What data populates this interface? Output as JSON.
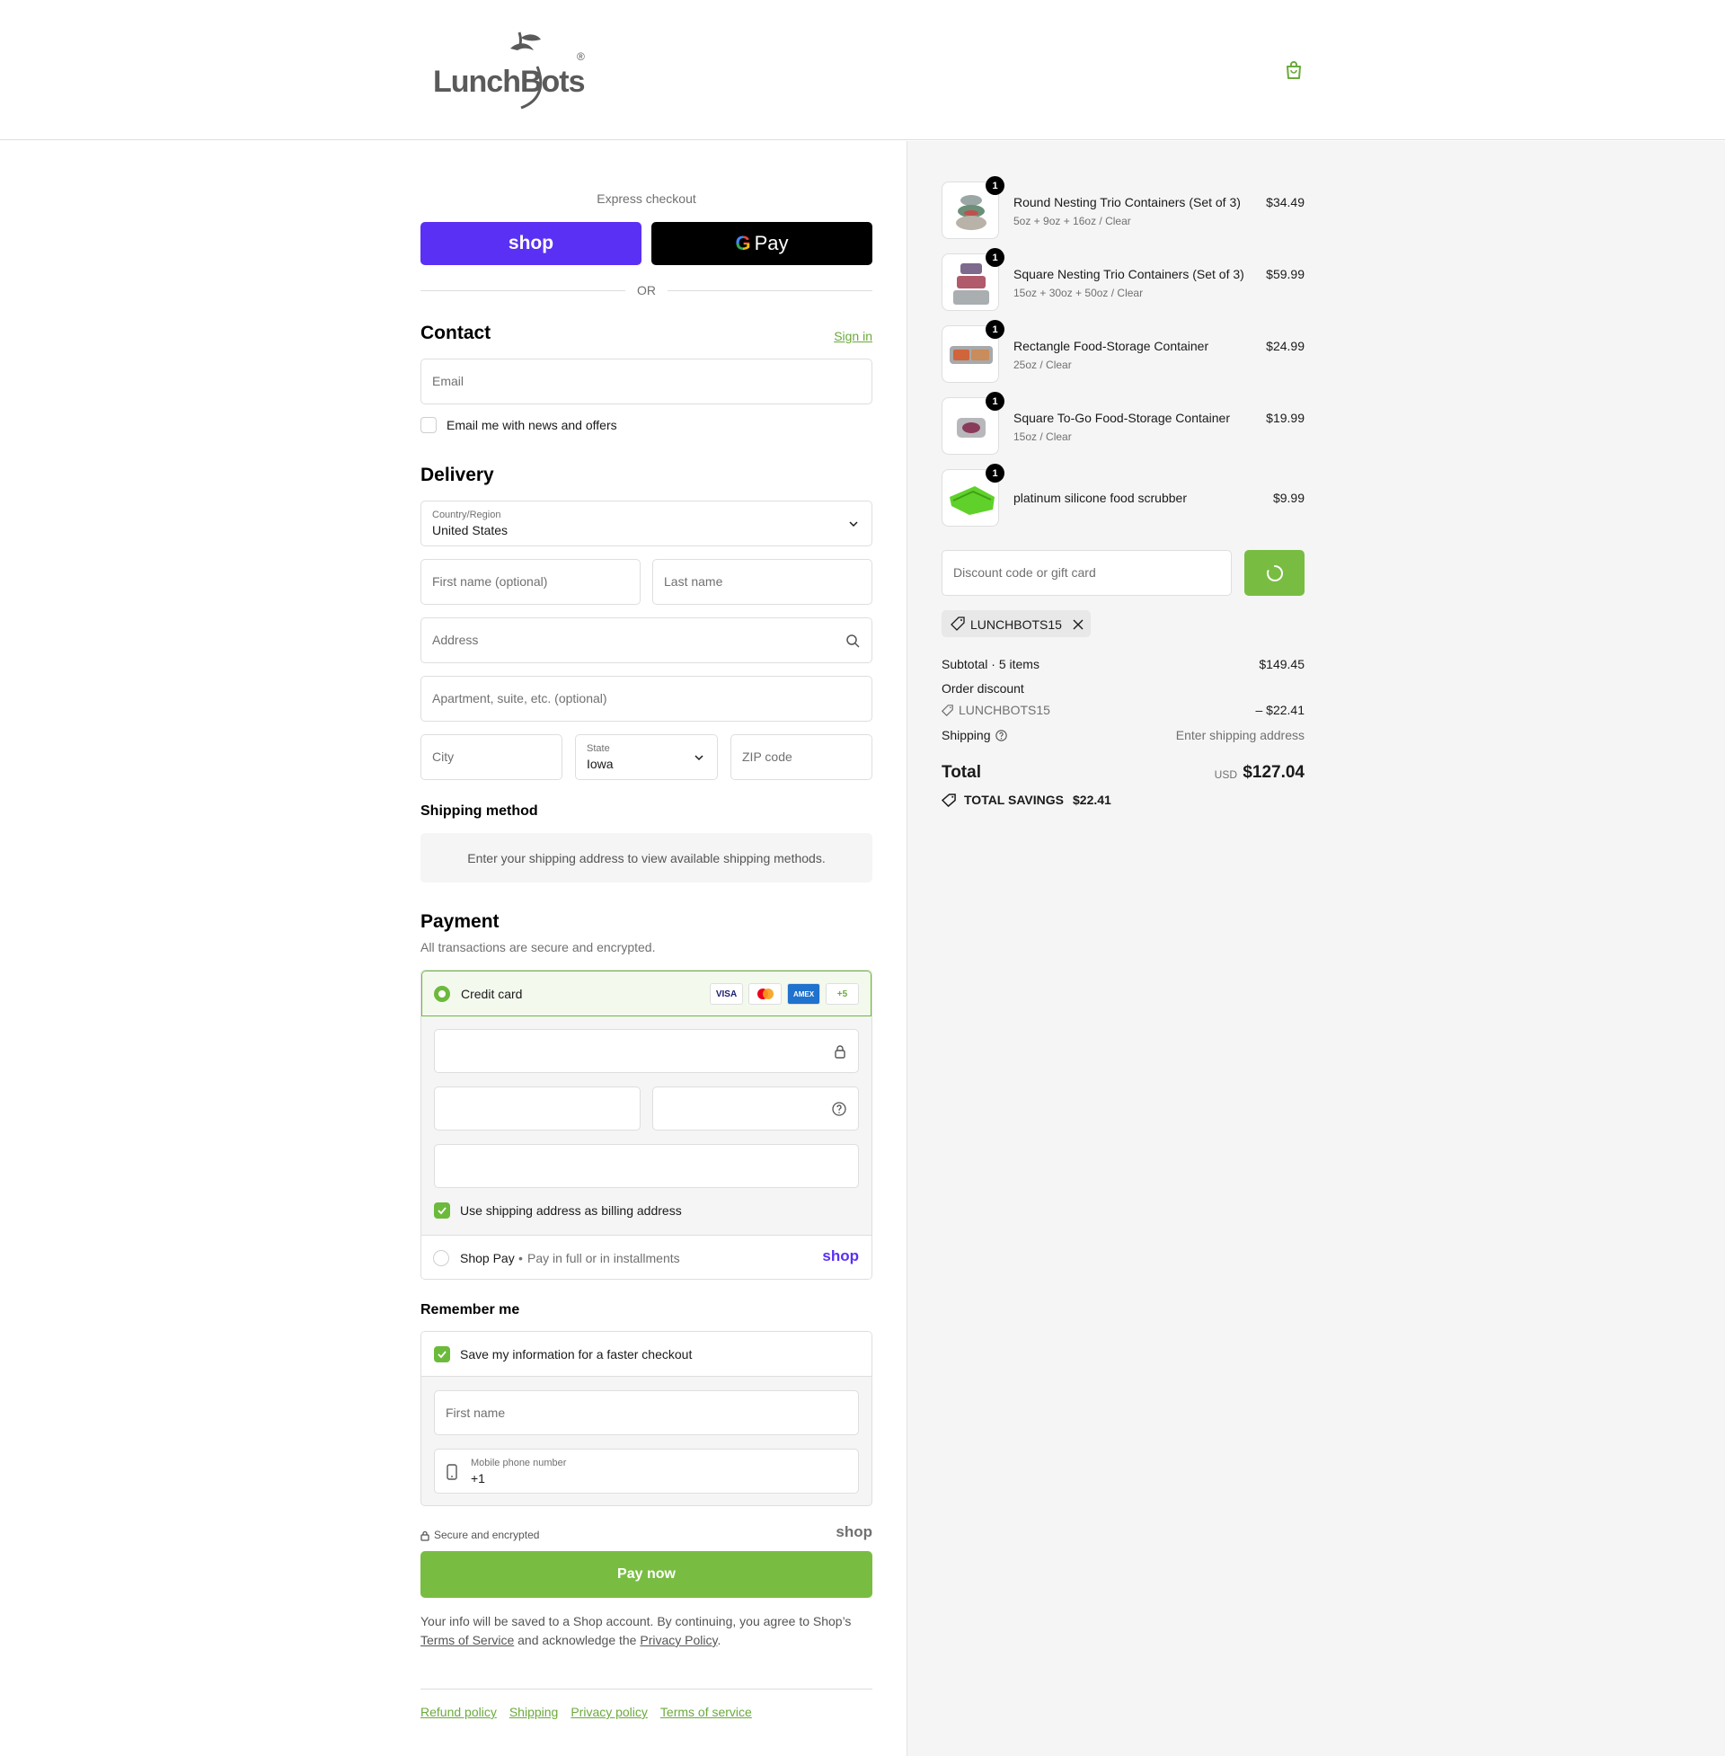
{
  "brand": {
    "logo_text": "LunchBots",
    "reg_mark": "®"
  },
  "express": {
    "label": "Express checkout",
    "shop_label": "shop",
    "gpay_g": "G",
    "gpay_label": "Pay",
    "or_label": "OR"
  },
  "contact": {
    "heading": "Contact",
    "sign_in": "Sign in",
    "email_placeholder": "Email",
    "newsletter_label": "Email me with news and offers"
  },
  "delivery": {
    "heading": "Delivery",
    "country_label": "Country/Region",
    "country_value": "United States",
    "first_name_placeholder": "First name (optional)",
    "last_name_placeholder": "Last name",
    "address_placeholder": "Address",
    "apartment_placeholder": "Apartment, suite, etc. (optional)",
    "city_placeholder": "City",
    "state_label": "State",
    "state_value": "Iowa",
    "zip_placeholder": "ZIP code"
  },
  "shipping_method": {
    "heading": "Shipping method",
    "message": "Enter your shipping address to view available shipping methods."
  },
  "payment": {
    "heading": "Payment",
    "subtitle": "All transactions are secure and encrypted.",
    "credit_card_label": "Credit card",
    "card_brands": [
      "VISA",
      "MC",
      "AMEX",
      "+5"
    ],
    "billing_same_label": "Use shipping address as billing address",
    "shop_pay_label": "Shop Pay",
    "shop_pay_sub": "Pay in full or in installments",
    "shop_pay_logo": "shop"
  },
  "remember": {
    "heading": "Remember me",
    "save_label": "Save my information for a faster checkout",
    "first_name_placeholder": "First name",
    "phone_label": "Mobile phone number",
    "phone_value": "+1",
    "secure_label": "Secure and encrypted",
    "shop_logo": "shop"
  },
  "pay_now_label": "Pay now",
  "legal": {
    "text_1": "Your info will be saved to a Shop account. By continuing, you agree to Shop’s",
    "terms_link": "Terms of Service",
    "text_2": "and acknowledge the",
    "privacy_link": "Privacy Policy",
    "text_3": "."
  },
  "footer_links": [
    "Refund policy",
    "Shipping",
    "Privacy policy",
    "Terms of service"
  ],
  "colors": {
    "accent": "#78bd42",
    "shop_purple": "#5a31f4",
    "link_green": "#6aaa3c"
  },
  "cart": {
    "items": [
      {
        "name": "Round Nesting Trio Containers (Set of 3)",
        "variant": "5oz + 9oz + 16oz / Clear",
        "price": "$34.49",
        "qty": "1"
      },
      {
        "name": "Square Nesting Trio Containers (Set of 3)",
        "variant": "15oz + 30oz + 50oz / Clear",
        "price": "$59.99",
        "qty": "1"
      },
      {
        "name": "Rectangle Food-Storage Container",
        "variant": "25oz / Clear",
        "price": "$24.99",
        "qty": "1"
      },
      {
        "name": "Square To-Go Food-Storage Container",
        "variant": "15oz / Clear",
        "price": "$19.99",
        "qty": "1"
      },
      {
        "name": "platinum silicone food scrubber",
        "variant": "",
        "price": "$9.99",
        "qty": "1"
      }
    ],
    "discount_placeholder": "Discount code or gift card",
    "applied_code": "LUNCHBOTS15",
    "subtotal_label": "Subtotal · 5 items",
    "subtotal_value": "$149.45",
    "order_discount_label": "Order discount",
    "discount_code": "LUNCHBOTS15",
    "discount_value": "– $22.41",
    "shipping_label": "Shipping",
    "shipping_value": "Enter shipping address",
    "total_label": "Total",
    "currency": "USD",
    "total_value": "$127.04",
    "savings_label": "TOTAL SAVINGS",
    "savings_value": "$22.41"
  }
}
